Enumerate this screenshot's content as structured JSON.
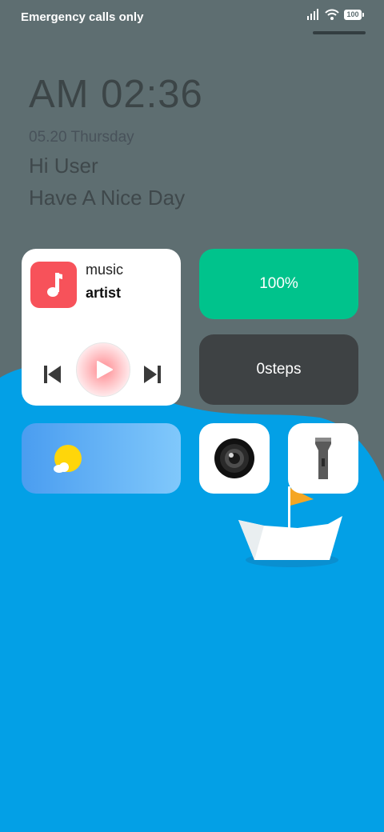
{
  "status_bar": {
    "carrier": "Emergency calls only",
    "battery": "100",
    "icons": [
      "signal-icon",
      "wifi-icon",
      "battery-icon"
    ]
  },
  "lockscreen": {
    "time": "AM 02:36",
    "date": "05.20 Thursday",
    "greeting": "Hi User",
    "message": "Have A Nice Day"
  },
  "widgets": {
    "music": {
      "title": "music",
      "artist": "artist",
      "icons": [
        "music-note-icon",
        "previous-icon",
        "play-icon",
        "next-icon"
      ]
    },
    "battery": {
      "label": "100%"
    },
    "steps": {
      "label": "0steps"
    },
    "weather": {
      "icon": "sun-cloud-icon"
    },
    "camera": {
      "icon": "camera-icon"
    },
    "flashlight": {
      "icon": "flashlight-icon"
    }
  },
  "colors": {
    "background": "#5e6e71",
    "sea": "#03a0e6",
    "music_art": "#f7525a",
    "battery_card": "#00c38c",
    "steps_card": "#3e4244",
    "flag": "#f5a623"
  }
}
